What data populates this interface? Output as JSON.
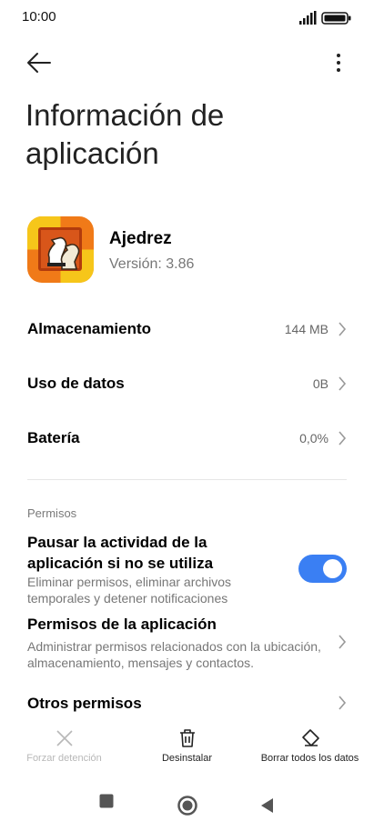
{
  "status": {
    "time": "10:00"
  },
  "header": {
    "title": "Información de aplicación"
  },
  "app": {
    "name": "Ajedrez",
    "version": "Versión: 3.86"
  },
  "rows": [
    {
      "label": "Almacenamiento",
      "value": "144 MB"
    },
    {
      "label": "Uso de datos",
      "value": "0B"
    },
    {
      "label": "Batería",
      "value": "0,0%"
    }
  ],
  "permissions": {
    "section_label": "Permisos",
    "pause": {
      "title": "Pausar la actividad de la aplicación si no se utiliza",
      "description": "Eliminar permisos, eliminar archivos temporales y detener notificaciones",
      "enabled": true
    },
    "app_permissions": {
      "title": "Permisos de la aplicación",
      "description": "Administrar permisos relacionados con la ubicación, almacenamiento, mensajes y contactos."
    },
    "other": {
      "title": "Otros permisos"
    }
  },
  "actions": {
    "force_stop": "Forzar detención",
    "uninstall": "Desinstalar",
    "clear_data": "Borrar todos los datos"
  },
  "colors": {
    "accent": "#3a7ff3",
    "disabled": "#b8b8b8",
    "icon_orange": "#f07a18",
    "icon_yellow": "#f6c61a"
  }
}
